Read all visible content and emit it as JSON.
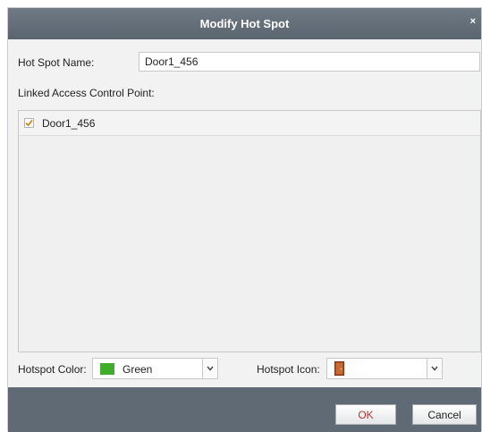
{
  "dialog": {
    "title": "Modify Hot Spot",
    "close_glyph": "×"
  },
  "form": {
    "name_label": "Hot Spot Name:",
    "name_value": "Door1_456",
    "linked_label": "Linked Access Control Point:"
  },
  "access_points": [
    {
      "label": "Door1_456",
      "checked": true
    }
  ],
  "hotspot_color": {
    "label": "Hotspot Color:",
    "value": "Green",
    "swatch_color": "#3fae2a"
  },
  "hotspot_icon": {
    "label": "Hotspot Icon:",
    "icon": "door-icon",
    "icon_color": "#b5521f"
  },
  "buttons": {
    "ok": "OK",
    "cancel": "Cancel"
  },
  "colors": {
    "title_bar": "#5b6570",
    "footer": "#5f6a74",
    "ok_text": "#c0302a",
    "checkmark": "#d08a18"
  }
}
